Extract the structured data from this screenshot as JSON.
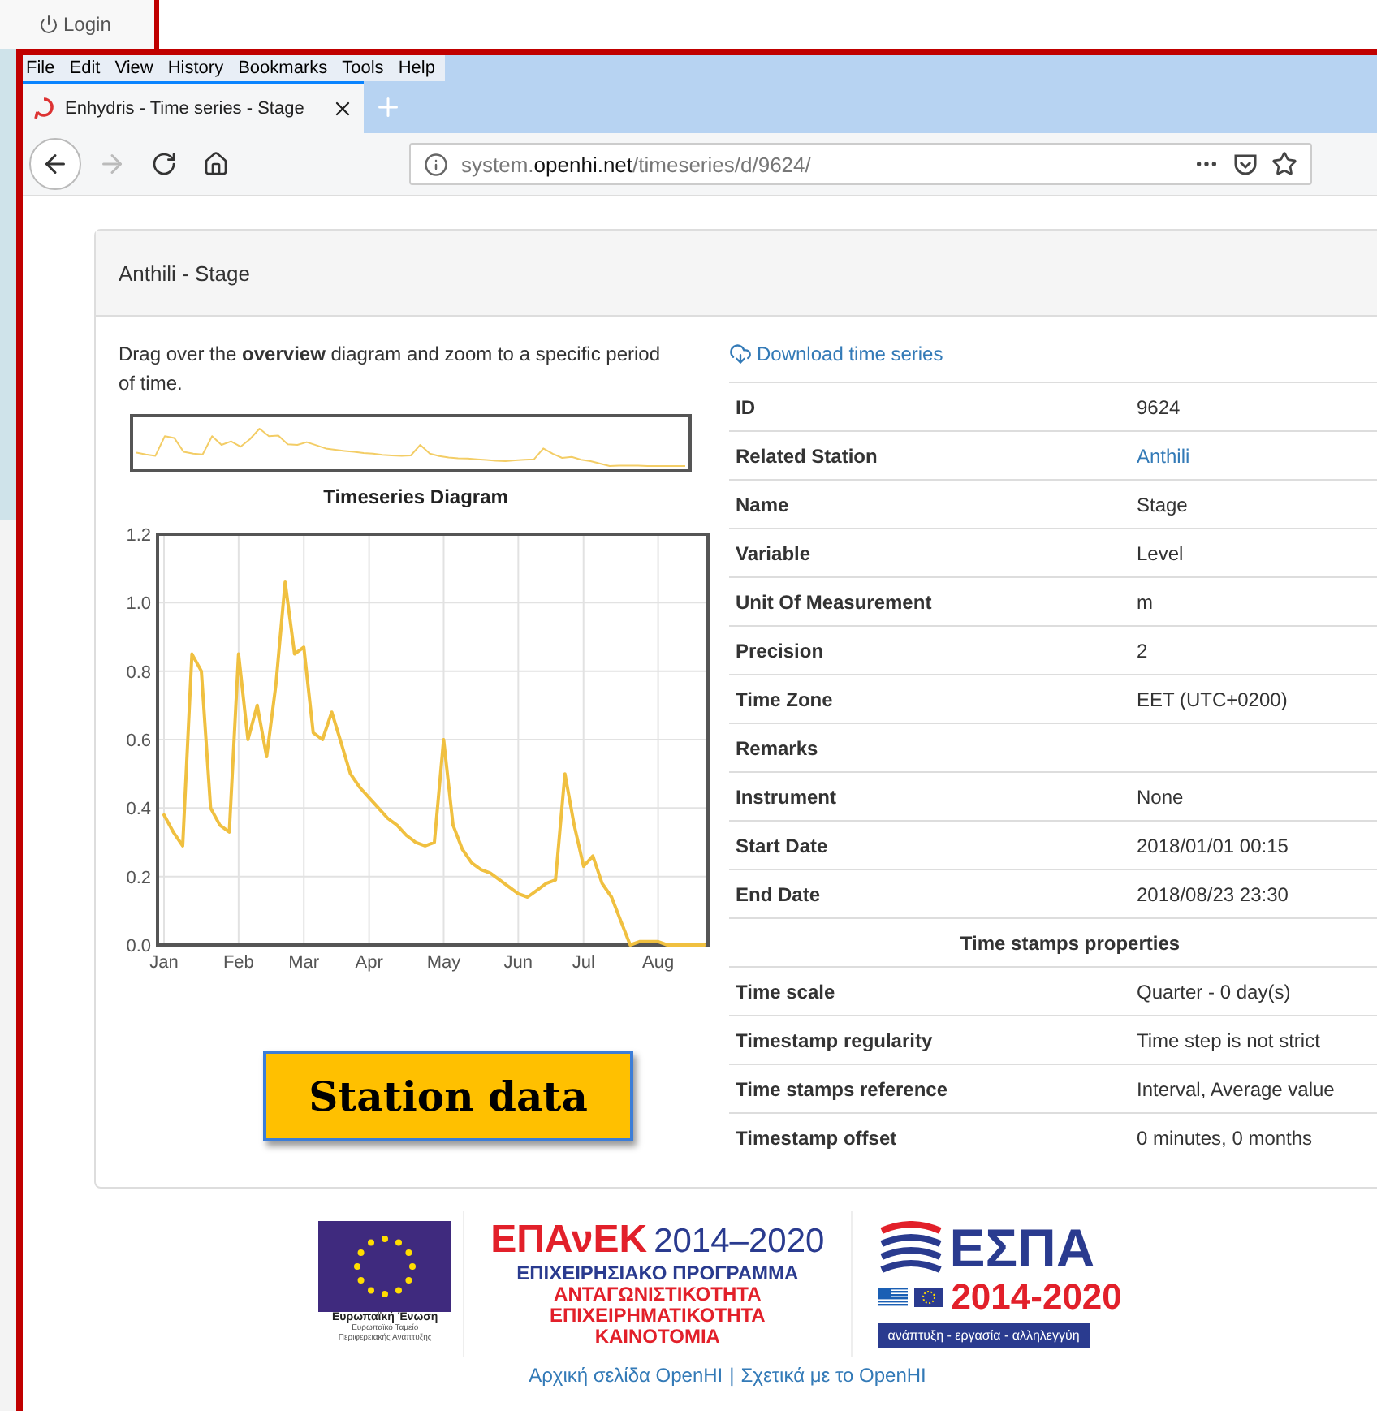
{
  "background_page": {
    "login_label": "Login"
  },
  "browser": {
    "menu": [
      {
        "label": "File"
      },
      {
        "label": "Edit"
      },
      {
        "label": "View"
      },
      {
        "label": "History"
      },
      {
        "label": "Bookmarks"
      },
      {
        "label": "Tools"
      },
      {
        "label": "Help"
      }
    ],
    "tab": {
      "title": "Enhydris - Time series - Stage",
      "selected": true
    },
    "nav_buttons": [
      {
        "kind": "back",
        "disabled": false
      },
      {
        "kind": "forward",
        "disabled": true
      },
      {
        "kind": "reload",
        "disabled": false
      },
      {
        "kind": "home",
        "disabled": false
      }
    ],
    "url": {
      "prefix": "system.",
      "domain": "openhi.net",
      "path": "/timeseries/d/9624/"
    }
  },
  "panel": {
    "title": "Anthili - Stage",
    "instructions": "Drag over the **overview** diagram and zoom to a specific period of time.",
    "chart_data": {
      "type": "line",
      "title": "Timeseries Diagram",
      "grid": true,
      "ylim": [
        0,
        1.2
      ],
      "yticks": [
        {
          "value": 0,
          "label": "0.0"
        },
        {
          "value": 0.2,
          "label": "0.2"
        },
        {
          "value": 0.4,
          "label": "0.4"
        },
        {
          "value": 0.6,
          "label": "0.6"
        },
        {
          "value": 0.8,
          "label": "0.8"
        },
        {
          "value": 1,
          "label": "1.0"
        },
        {
          "value": 1.2,
          "label": "1.2"
        }
      ],
      "categories": [
        "Jan",
        null,
        null,
        null,
        null,
        null,
        null,
        null,
        "Feb",
        null,
        null,
        null,
        null,
        null,
        null,
        "Mar",
        null,
        null,
        null,
        null,
        null,
        null,
        "Apr",
        null,
        null,
        null,
        null,
        null,
        null,
        null,
        "May",
        null,
        null,
        null,
        null,
        null,
        null,
        null,
        "Jun",
        null,
        null,
        null,
        null,
        null,
        null,
        "Jul",
        null,
        null,
        null,
        null,
        null,
        null,
        null,
        "Aug",
        null,
        null,
        null,
        null,
        null
      ],
      "series": [
        {
          "color": "#f0c040",
          "values": [
            0.38,
            0.33,
            0.29,
            0.85,
            0.8,
            0.4,
            0.35,
            0.33,
            0.85,
            0.6,
            0.7,
            0.55,
            0.76,
            1.06,
            0.85,
            0.87,
            0.62,
            0.6,
            0.68,
            0.59,
            0.5,
            0.46,
            0.43,
            0.4,
            0.37,
            0.35,
            0.32,
            0.3,
            0.29,
            0.3,
            0.6,
            0.35,
            0.28,
            0.24,
            0.22,
            0.21,
            0.19,
            0.17,
            0.15,
            0.14,
            0.16,
            0.18,
            0.19,
            0.5,
            0.35,
            0.23,
            0.26,
            0.18,
            0.14,
            0.07,
            0.0,
            0.01,
            0.01,
            0.01,
            0.0,
            0.0,
            0.0,
            0.0,
            0.0
          ]
        }
      ]
    },
    "annotation": "Station data",
    "download_link": "Download time series",
    "rows": [
      {
        "kind": "pair",
        "key": "ID",
        "value": "9624"
      },
      {
        "kind": "link",
        "key": "Related Station",
        "value": "Anthili"
      },
      {
        "kind": "pair",
        "key": "Name",
        "value": "Stage"
      },
      {
        "kind": "pair",
        "key": "Variable",
        "value": "Level"
      },
      {
        "kind": "pair",
        "key": "Unit Of Measurement",
        "value": "m"
      },
      {
        "kind": "pair",
        "key": "Precision",
        "value": "2"
      },
      {
        "kind": "pair",
        "key": "Time Zone",
        "value": "EET (UTC+0200)"
      },
      {
        "kind": "pair",
        "key": "Remarks",
        "value": ""
      },
      {
        "kind": "pair",
        "key": "Instrument",
        "value": "None"
      },
      {
        "kind": "pair",
        "key": "Start Date",
        "value": "2018/01/01 00:15"
      },
      {
        "kind": "pair",
        "key": "End Date",
        "value": "2018/08/23 23:30"
      },
      {
        "kind": "section",
        "key": "Time stamps properties"
      },
      {
        "kind": "pair",
        "key": "Time scale",
        "value": "Quarter - 0 day(s)"
      },
      {
        "kind": "pair",
        "key": "Timestamp regularity",
        "value": "Time step is not strict"
      },
      {
        "kind": "pair",
        "key": "Time stamps reference",
        "value": "Interval, Average value"
      },
      {
        "kind": "pair",
        "key": "Timestamp offset",
        "value": "0 minutes, 0 months"
      }
    ]
  },
  "footer": {
    "eu_logo": {
      "name": "Ευρωπαϊκή Ένωση",
      "line_1": "Ευρωπαϊκό Ταμείο",
      "line_2": "Περιφερειακής Ανάπτυξης"
    },
    "epanek_logo": {
      "name": "ΕΠΑνΕΚ",
      "years": "2014–2020",
      "lines": [
        "ΕΠΙΧΕΙΡΗΣΙΑΚΟ ΠΡΟΓΡΑΜΜΑ",
        "ΑΝΤΑΓΩΝΙΣΤΙΚΟΤΗΤΑ",
        "ΕΠΙΧΕΙΡΗΜΑΤΙΚΟΤΗΤΑ",
        "ΚΑΙΝΟΤΟΜΙΑ"
      ]
    },
    "espa_logo": {
      "name": "ΕΣΠΑ",
      "years": "2014-2020",
      "slogan": "ανάπτυξη - εργασία - αλληλεγγύη"
    },
    "links": [
      "Αρχική σελίδα OpenHI",
      "Σχετικά με το OpenHI"
    ],
    "separator": "|"
  }
}
